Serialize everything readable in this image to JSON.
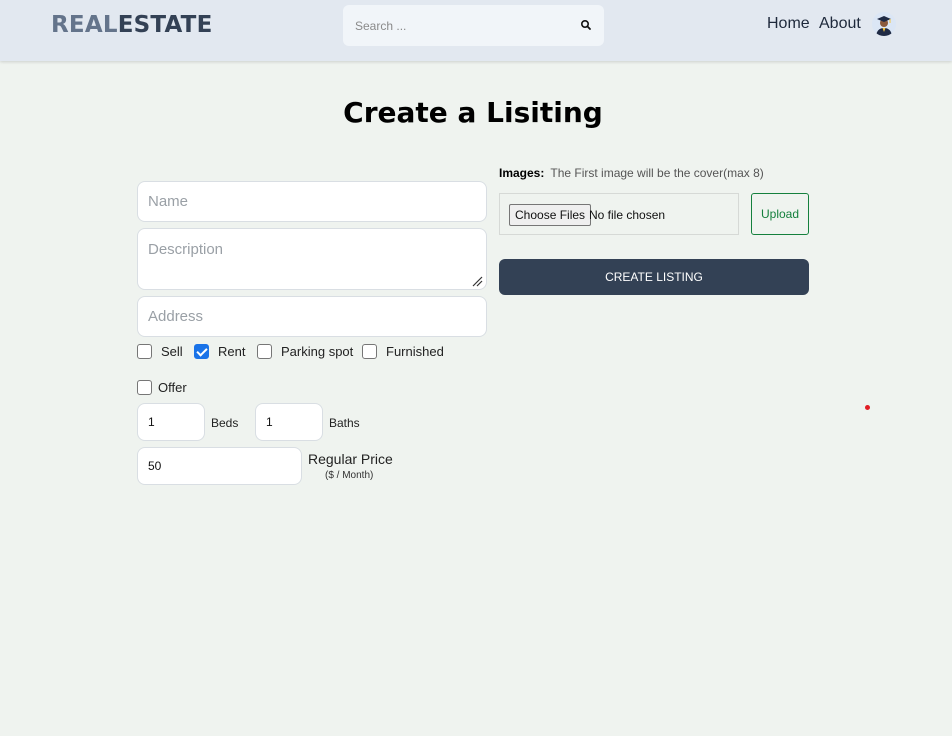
{
  "header": {
    "logo_part1": "REAL",
    "logo_part2": "ESTATE",
    "search_placeholder": "Search ...",
    "nav": {
      "home": "Home",
      "about": "About"
    },
    "colors": {
      "background": "#e2e8f0",
      "logo_light": "#64748b",
      "logo_dark": "#334155"
    }
  },
  "page": {
    "title": "Create a Lisiting"
  },
  "form": {
    "name_placeholder": "Name",
    "description_placeholder": "Description",
    "address_placeholder": "Address",
    "checkboxes": [
      {
        "label": "Sell",
        "checked": false
      },
      {
        "label": "Rent",
        "checked": true
      },
      {
        "label": "Parking spot",
        "checked": false
      },
      {
        "label": "Furnished",
        "checked": false
      },
      {
        "label": "Offer",
        "checked": false
      }
    ],
    "beds": {
      "value": "1",
      "label": "Beds"
    },
    "baths": {
      "value": "1",
      "label": "Baths"
    },
    "price": {
      "value": "50",
      "label": "Regular Price",
      "sub_label": "($ / Month)"
    }
  },
  "images": {
    "label": "Images:",
    "hint": "The First image will be the cover(max 8)",
    "choose_label": "Choose Files",
    "no_file_text": "No file chosen",
    "upload_label": "Upload",
    "create_label": "CREATE LISTING",
    "colors": {
      "upload": "#15803d",
      "create_bg": "#334155"
    }
  }
}
